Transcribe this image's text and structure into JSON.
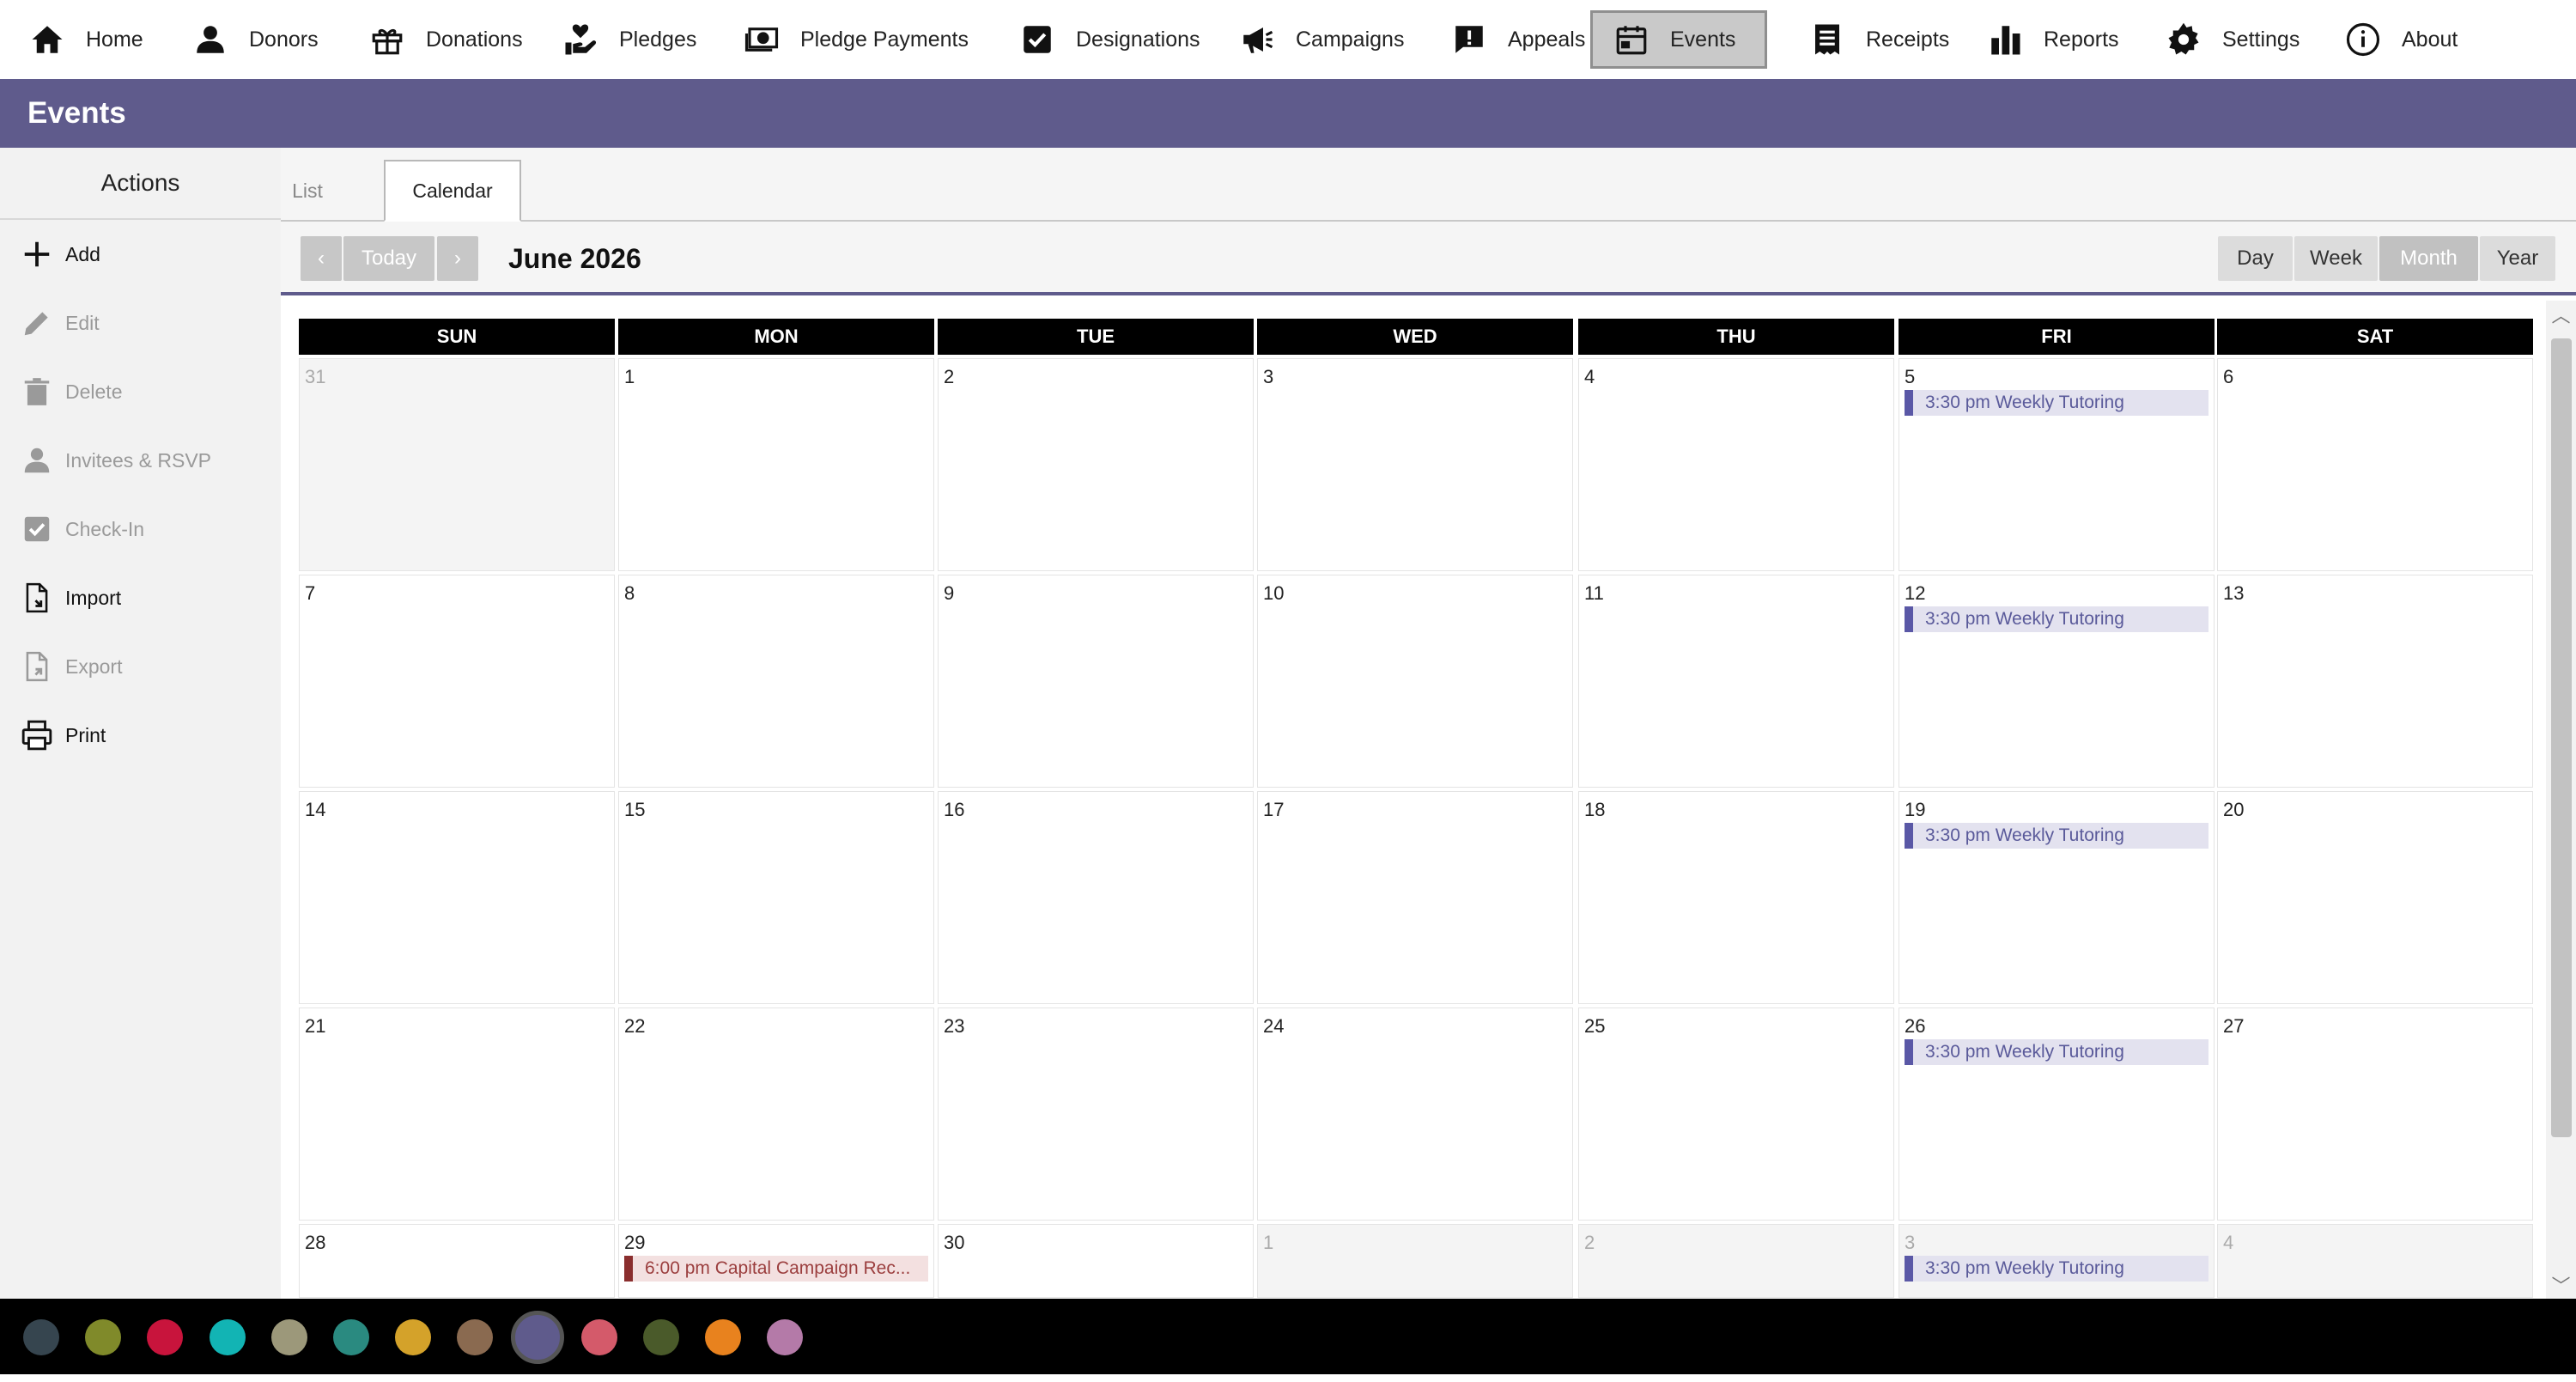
{
  "nav": {
    "items": [
      {
        "id": "home",
        "label": "Home",
        "icon": "home-icon"
      },
      {
        "id": "donors",
        "label": "Donors",
        "icon": "person-icon"
      },
      {
        "id": "donations",
        "label": "Donations",
        "icon": "gift-icon"
      },
      {
        "id": "pledges",
        "label": "Pledges",
        "icon": "hand-heart-icon"
      },
      {
        "id": "pledge-payments",
        "label": "Pledge Payments",
        "icon": "money-icon"
      },
      {
        "id": "designations",
        "label": "Designations",
        "icon": "checkbox-icon"
      },
      {
        "id": "campaigns",
        "label": "Campaigns",
        "icon": "megaphone-icon"
      },
      {
        "id": "appeals",
        "label": "Appeals",
        "icon": "alert-message-icon"
      },
      {
        "id": "events",
        "label": "Events",
        "icon": "calendar-icon"
      },
      {
        "id": "receipts",
        "label": "Receipts",
        "icon": "receipt-icon"
      },
      {
        "id": "reports",
        "label": "Reports",
        "icon": "bar-chart-icon"
      },
      {
        "id": "settings",
        "label": "Settings",
        "icon": "gear-icon"
      },
      {
        "id": "about",
        "label": "About",
        "icon": "info-icon"
      }
    ],
    "active": "events"
  },
  "page": {
    "title": "Events"
  },
  "sidebar": {
    "header": "Actions",
    "items": [
      {
        "label": "Add",
        "icon": "plus-icon",
        "enabled": true
      },
      {
        "label": "Edit",
        "icon": "pencil-icon",
        "enabled": false
      },
      {
        "label": "Delete",
        "icon": "trash-icon",
        "enabled": false
      },
      {
        "label": "Invitees & RSVP",
        "icon": "person-icon",
        "enabled": false
      },
      {
        "label": "Check-In",
        "icon": "checkbox-icon",
        "enabled": false
      },
      {
        "label": "Import",
        "icon": "file-import-icon",
        "enabled": true
      },
      {
        "label": "Export",
        "icon": "file-export-icon",
        "enabled": false
      },
      {
        "label": "Print",
        "icon": "printer-icon",
        "enabled": true
      }
    ]
  },
  "tabs": {
    "list": "List",
    "calendar": "Calendar",
    "active": "calendar"
  },
  "toolbar": {
    "prev": "‹",
    "today": "Today",
    "next": "›",
    "month_title": "June 2026",
    "views": [
      "Day",
      "Week",
      "Month",
      "Year"
    ],
    "active_view": "Month"
  },
  "calendar": {
    "weekdays": [
      "SUN",
      "MON",
      "TUE",
      "WED",
      "THU",
      "FRI",
      "SAT"
    ],
    "weeks": [
      [
        {
          "day": "31",
          "other": true
        },
        {
          "day": "1"
        },
        {
          "day": "2"
        },
        {
          "day": "3"
        },
        {
          "day": "4"
        },
        {
          "day": "5",
          "event": {
            "text": "3:30 pm Weekly Tutoring",
            "color": "purple"
          }
        },
        {
          "day": "6"
        }
      ],
      [
        {
          "day": "7"
        },
        {
          "day": "8"
        },
        {
          "day": "9"
        },
        {
          "day": "10"
        },
        {
          "day": "11"
        },
        {
          "day": "12",
          "event": {
            "text": "3:30 pm Weekly Tutoring",
            "color": "purple"
          }
        },
        {
          "day": "13"
        }
      ],
      [
        {
          "day": "14"
        },
        {
          "day": "15"
        },
        {
          "day": "16"
        },
        {
          "day": "17"
        },
        {
          "day": "18"
        },
        {
          "day": "19",
          "event": {
            "text": "3:30 pm Weekly Tutoring",
            "color": "purple"
          }
        },
        {
          "day": "20"
        }
      ],
      [
        {
          "day": "21"
        },
        {
          "day": "22"
        },
        {
          "day": "23"
        },
        {
          "day": "24"
        },
        {
          "day": "25"
        },
        {
          "day": "26",
          "event": {
            "text": "3:30 pm Weekly Tutoring",
            "color": "purple"
          }
        },
        {
          "day": "27"
        }
      ],
      [
        {
          "day": "28"
        },
        {
          "day": "29",
          "event": {
            "text": "6:00 pm Capital Campaign Rec...",
            "color": "red"
          }
        },
        {
          "day": "30"
        },
        {
          "day": "1",
          "other": true
        },
        {
          "day": "2",
          "other": true
        },
        {
          "day": "3",
          "other": true,
          "event": {
            "text": "3:30 pm Weekly Tutoring",
            "color": "purple"
          }
        },
        {
          "day": "4",
          "other": true
        }
      ]
    ]
  },
  "theme": {
    "header_color": "#5f5b8c",
    "swatches": [
      "#36454f",
      "#808a2a",
      "#c8143c",
      "#12b4b4",
      "#9c987a",
      "#2a8a80",
      "#d4a22a",
      "#8a6a50",
      "#5f5b8c",
      "#d45a6a",
      "#4a5a2a",
      "#e8821e",
      "#b47aa8"
    ],
    "selected_swatch": 8
  }
}
